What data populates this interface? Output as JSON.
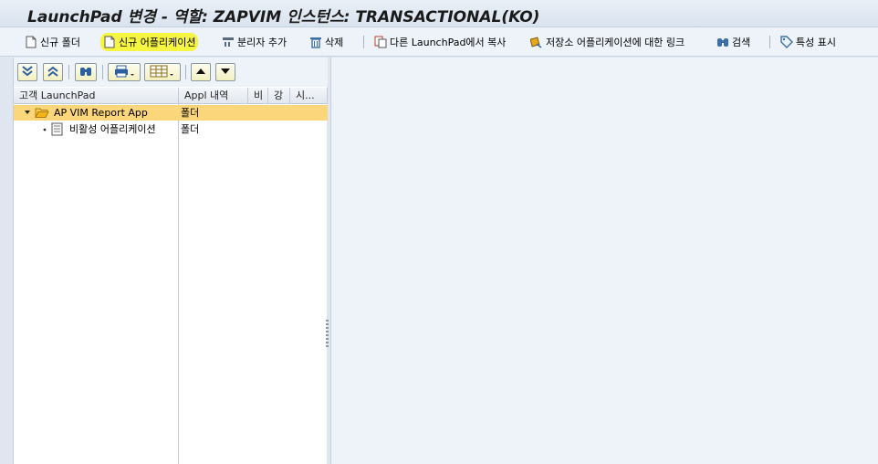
{
  "window": {
    "title": "LaunchPad 변경 - 역할: ZAPVIM 인스턴스: TRANSACTIONAL(KO)"
  },
  "toolbar": {
    "new_folder": "신규 폴더",
    "new_application": "신규 어플리케이션",
    "add_separator": "분리자 추가",
    "delete": "삭제",
    "copy_from_other": "다른 LaunchPad에서 복사",
    "repository_link": "저장소 어플리케이션에 대한 링크",
    "search": "검색",
    "show_properties": "특성 표시"
  },
  "tree": {
    "columns": {
      "name": "고객 LaunchPad",
      "appl_desc": "Appl 내역",
      "col3": "비",
      "col4": "강",
      "col5": "시..."
    },
    "rows": [
      {
        "name": "AP VIM Report App",
        "appl_desc": "폴더"
      },
      {
        "name": "비활성 어플리케이션",
        "appl_desc": "폴더"
      }
    ]
  },
  "colors": {
    "selected_row": "#fbd67a",
    "highlight": "#f5f542",
    "folder": "#e8a817"
  }
}
